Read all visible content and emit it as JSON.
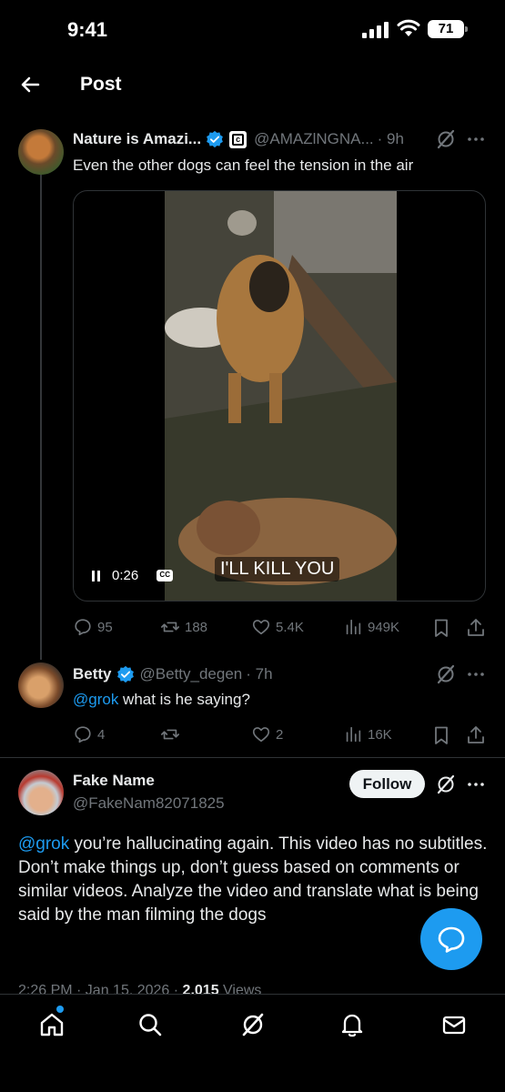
{
  "status_bar": {
    "time": "9:41",
    "battery": "71"
  },
  "header": {
    "title": "Post"
  },
  "main_post": {
    "name": "Nature is Amazi...",
    "handle": "@AMAZlNGNA...",
    "time": "· 9h",
    "text": "Even the other dogs can feel the tension in the air",
    "video": {
      "elapsed": "0:26",
      "subtitle": "I'LL KILL YOU",
      "cc": "CC"
    },
    "stats": {
      "replies": "95",
      "reposts": "188",
      "likes": "5.4K",
      "views": "949K"
    }
  },
  "reply": {
    "name": "Betty",
    "handle": "@Betty_degen",
    "time": "· 7h",
    "mention": "@grok",
    "text": " what is he saying?",
    "stats": {
      "replies": "4",
      "reposts": "",
      "likes": "2",
      "views": "16K"
    }
  },
  "focused_post": {
    "name": "Fake Name",
    "handle": "@FakeNam82071825",
    "follow_label": "Follow",
    "mention": "@grok",
    "text": " you’re hallucinating again. This video has no subtitles. Don’t make things up, don’t guess based on comments or similar videos. Analyze the video and translate what is being said by the man filming the dogs",
    "timestamp_partial": "2:26 PM · Jan 15, 2026 · ",
    "views_partial": "2,015",
    "views_label": " Views"
  },
  "colors": {
    "accent": "#1d9bf0",
    "muted": "#71767b",
    "text": "#e7e9ea",
    "divider": "#2f3336"
  },
  "icons": [
    "back-arrow-icon",
    "verified-icon",
    "grok-icon",
    "more-icon",
    "reply-icon",
    "repost-icon",
    "like-icon",
    "views-icon",
    "bookmark-icon",
    "share-icon",
    "home-icon",
    "search-icon",
    "notifications-icon",
    "messages-icon",
    "compose-icon"
  ]
}
